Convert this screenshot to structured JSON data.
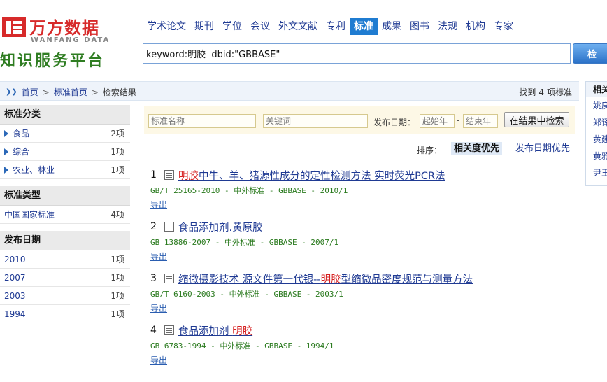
{
  "logo": {
    "cn": "万方数据",
    "en": "WANFANG DATA",
    "slogan": "知识服务平台"
  },
  "nav": {
    "items": [
      "学术论文",
      "期刊",
      "学位",
      "会议",
      "外文文献",
      "专利",
      "标准",
      "成果",
      "图书",
      "法规",
      "机构",
      "专家"
    ],
    "active": "标准"
  },
  "search": {
    "query": "keyword:明胶  dbid:\"GBBASE\"",
    "button_label": "检 索"
  },
  "breadcrumb": {
    "home": "首页",
    "standards_home": "标准首页",
    "current": "检索结果"
  },
  "result_count": {
    "prefix": "找到",
    "count": "4",
    "suffix": "项标准"
  },
  "sidebar": {
    "sections": [
      {
        "title": "标准分类",
        "items": [
          {
            "label": "食品",
            "count": "2项"
          },
          {
            "label": "综合",
            "count": "1项"
          },
          {
            "label": "农业、林业",
            "count": "1项"
          }
        ]
      },
      {
        "title": "标准类型",
        "items": [
          {
            "label": "中国国家标准",
            "count": "4项"
          }
        ]
      },
      {
        "title": "发布日期",
        "items": [
          {
            "label": "2010",
            "count": "1项"
          },
          {
            "label": "2007",
            "count": "1项"
          },
          {
            "label": "2003",
            "count": "1项"
          },
          {
            "label": "1994",
            "count": "1项"
          }
        ]
      }
    ]
  },
  "filter": {
    "name_placeholder": "标准名称",
    "keyword_placeholder": "关键词",
    "date_label": "发布日期：",
    "start_year_placeholder": "起始年",
    "end_year_placeholder": "结束年",
    "button_label": "在结果中检索"
  },
  "sort": {
    "label": "排序：",
    "active": "相关度优先",
    "other": "发布日期优先"
  },
  "results": [
    {
      "num": "1",
      "title_pre": "",
      "title_hl": "明胶",
      "title_post": "中牛、羊、猪源性成分的定性检测方法  实时荧光PCR法",
      "meta": "GB/T 25165-2010 - 中外标准 - GBBASE - 2010/1",
      "export": "导出"
    },
    {
      "num": "2",
      "title_pre": "食品添加剂.黄原胶",
      "title_hl": "",
      "title_post": "",
      "meta": "GB 13886-2007 - 中外标准 - GBBASE - 2007/1",
      "export": "导出"
    },
    {
      "num": "3",
      "title_pre": "缩微摄影技术 源文件第一代银--",
      "title_hl": "明胶",
      "title_post": "型缩微品密度规范与测量方法",
      "meta": "GB/T 6160-2003 - 中外标准 - GBBASE - 2003/1",
      "export": "导出"
    },
    {
      "num": "4",
      "title_pre": "食品添加剂 ",
      "title_hl": "明胶",
      "title_post": "",
      "meta": "GB 6783-1994 - 中外标准 - GBBASE - 1994/1",
      "export": "导出"
    }
  ],
  "related_panel": {
    "title": "相关",
    "items": [
      "姚庚",
      "郑译",
      "黄建",
      "黄雅",
      "尹王"
    ]
  }
}
